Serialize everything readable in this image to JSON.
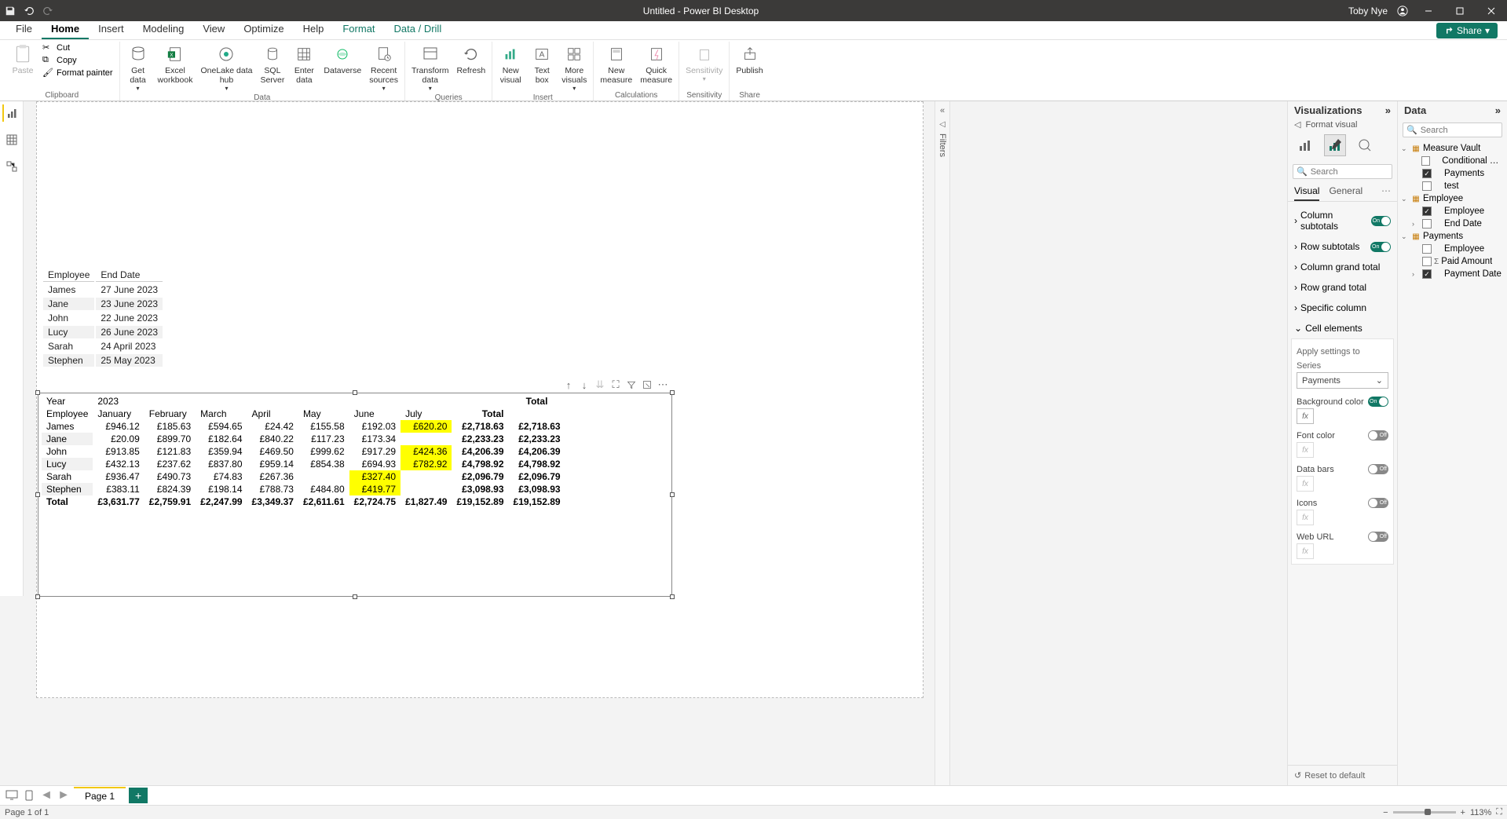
{
  "titlebar": {
    "title": "Untitled - Power BI Desktop",
    "user": "Toby Nye"
  },
  "ribbon_tabs": [
    "File",
    "Home",
    "Insert",
    "Modeling",
    "View",
    "Optimize",
    "Help",
    "Format",
    "Data / Drill"
  ],
  "ribbon_tabs_active": "Home",
  "share_label": "Share",
  "ribbon": {
    "clipboard": {
      "label": "Clipboard",
      "paste": "Paste",
      "cut": "Cut",
      "copy": "Copy",
      "format_painter": "Format painter"
    },
    "data": {
      "label": "Data",
      "get_data": "Get\ndata",
      "excel": "Excel\nworkbook",
      "onelake": "OneLake data\nhub",
      "sql": "SQL\nServer",
      "enter": "Enter\ndata",
      "dataverse": "Dataverse",
      "recent": "Recent\nsources"
    },
    "queries": {
      "label": "Queries",
      "transform": "Transform\ndata",
      "refresh": "Refresh"
    },
    "insert": {
      "label": "Insert",
      "new_visual": "New\nvisual",
      "text_box": "Text\nbox",
      "more": "More\nvisuals"
    },
    "calc": {
      "label": "Calculations",
      "new_measure": "New\nmeasure",
      "quick_measure": "Quick\nmeasure"
    },
    "sens": {
      "label": "Sensitivity",
      "sensitivity": "Sensitivity"
    },
    "share": {
      "label": "Share",
      "publish": "Publish"
    }
  },
  "filters_label": "Filters",
  "viz_pane": {
    "title": "Visualizations",
    "subtitle": "Format visual",
    "search_placeholder": "Search",
    "tabs": {
      "visual": "Visual",
      "general": "General"
    },
    "items": {
      "column_subtotals": "Column subtotals",
      "row_subtotals": "Row subtotals",
      "column_grand_total": "Column grand total",
      "row_grand_total": "Row grand total",
      "specific_column": "Specific column",
      "cell_elements": "Cell elements"
    },
    "cell": {
      "apply_label": "Apply settings to",
      "series_label": "Series",
      "series_value": "Payments",
      "bg_color": "Background color",
      "font_color": "Font color",
      "data_bars": "Data bars",
      "icons": "Icons",
      "web_url": "Web URL"
    },
    "reset": "Reset to default"
  },
  "data_pane": {
    "title": "Data",
    "search_placeholder": "Search",
    "tables": [
      {
        "name": "Measure Vault",
        "fields": [
          {
            "name": "Conditional For...",
            "checked": false
          },
          {
            "name": "Payments",
            "checked": true
          },
          {
            "name": "test",
            "checked": false
          }
        ]
      },
      {
        "name": "Employee",
        "fields": [
          {
            "name": "Employee",
            "checked": true
          },
          {
            "name": "End Date",
            "checked": false,
            "expandable": true
          }
        ]
      },
      {
        "name": "Payments",
        "fields": [
          {
            "name": "Employee",
            "checked": false
          },
          {
            "name": "Paid Amount",
            "checked": false,
            "sigma": true
          },
          {
            "name": "Payment Date",
            "checked": true,
            "expandable": true
          }
        ]
      }
    ]
  },
  "small_table": {
    "headers": [
      "Employee",
      "End Date"
    ],
    "rows": [
      [
        "James",
        "27 June 2023"
      ],
      [
        "Jane",
        "23 June 2023"
      ],
      [
        "John",
        "22 June 2023"
      ],
      [
        "Lucy",
        "26 June 2023"
      ],
      [
        "Sarah",
        "24 April 2023"
      ],
      [
        "Stephen",
        "25 May 2023"
      ]
    ]
  },
  "matrix": {
    "year_label": "Year",
    "year_value": "2023",
    "total_header": "Total",
    "row_header": "Employee",
    "months": [
      "January",
      "February",
      "March",
      "April",
      "May",
      "June",
      "July"
    ],
    "rows": [
      {
        "label": "James",
        "vals": [
          "£946.12",
          "£185.63",
          "£594.65",
          "£24.42",
          "£155.58",
          "£192.03",
          "£620.20"
        ],
        "total": "£2,718.63",
        "grand": "£2,718.63",
        "hl": [
          6
        ]
      },
      {
        "label": "Jane",
        "vals": [
          "£20.09",
          "£899.70",
          "£182.64",
          "£840.22",
          "£117.23",
          "£173.34",
          ""
        ],
        "total": "£2,233.23",
        "grand": "£2,233.23",
        "hl": []
      },
      {
        "label": "John",
        "vals": [
          "£913.85",
          "£121.83",
          "£359.94",
          "£469.50",
          "£999.62",
          "£917.29",
          "£424.36"
        ],
        "total": "£4,206.39",
        "grand": "£4,206.39",
        "hl": [
          6
        ]
      },
      {
        "label": "Lucy",
        "vals": [
          "£432.13",
          "£237.62",
          "£837.80",
          "£959.14",
          "£854.38",
          "£694.93",
          "£782.92"
        ],
        "total": "£4,798.92",
        "grand": "£4,798.92",
        "hl": [
          6
        ]
      },
      {
        "label": "Sarah",
        "vals": [
          "£936.47",
          "£490.73",
          "£74.83",
          "£267.36",
          "",
          "£327.40",
          ""
        ],
        "total": "£2,096.79",
        "grand": "£2,096.79",
        "hl": [
          5
        ]
      },
      {
        "label": "Stephen",
        "vals": [
          "£383.11",
          "£824.39",
          "£198.14",
          "£788.73",
          "£484.80",
          "£419.77",
          ""
        ],
        "total": "£3,098.93",
        "grand": "£3,098.93",
        "hl": [
          5
        ]
      }
    ],
    "total_row": {
      "label": "Total",
      "vals": [
        "£3,631.77",
        "£2,759.91",
        "£2,247.99",
        "£3,349.37",
        "£2,611.61",
        "£2,724.75",
        "£1,827.49"
      ],
      "total": "£19,152.89",
      "grand": "£19,152.89"
    }
  },
  "page_tab": "Page 1",
  "status": {
    "page": "Page 1 of 1",
    "zoom": "113%"
  }
}
